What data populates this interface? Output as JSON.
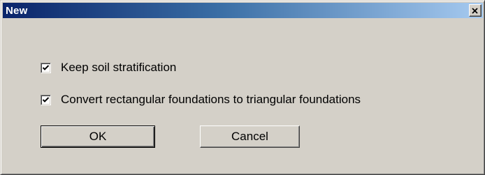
{
  "window": {
    "title": "New",
    "close_icon": "close-icon"
  },
  "options": [
    {
      "label": "Keep soil stratification",
      "checked": true
    },
    {
      "label": "Convert rectangular foundations to triangular foundations",
      "checked": true
    }
  ],
  "buttons": {
    "ok_label": "OK",
    "cancel_label": "Cancel"
  },
  "colors": {
    "titlebar_start": "#0a246a",
    "titlebar_end": "#a6caf0",
    "face": "#d4d0c8"
  }
}
